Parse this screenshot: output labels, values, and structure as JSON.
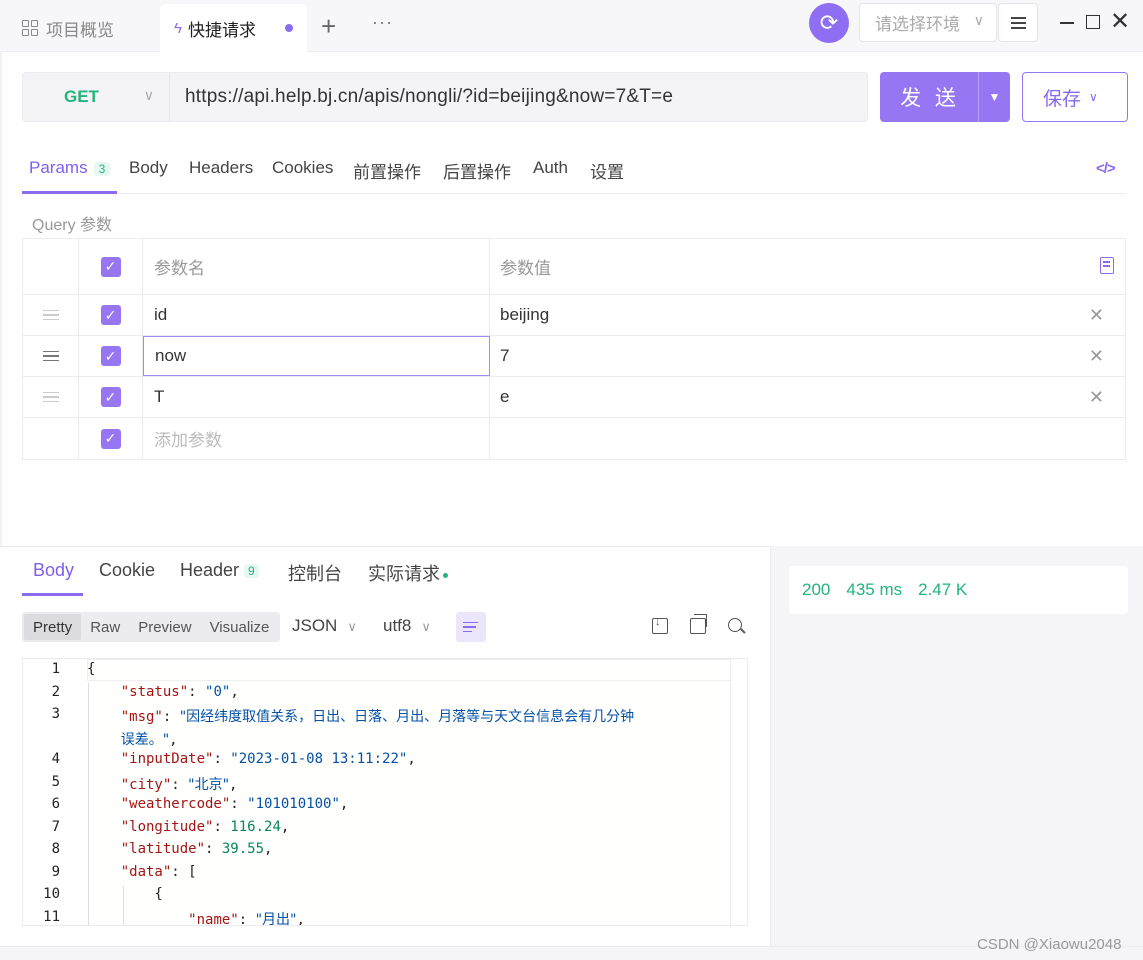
{
  "titlebar": {
    "tabs": [
      {
        "label": "项目概览"
      },
      {
        "label": "快捷请求"
      }
    ],
    "env_placeholder": "请选择环境"
  },
  "request": {
    "method": "GET",
    "url": "https://api.help.bj.cn/apis/nongli/?id=beijing&now=7&T=e",
    "send_label": "发 送",
    "save_label": "保存"
  },
  "req_tabs": [
    {
      "label": "Params",
      "badge": "3"
    },
    {
      "label": "Body"
    },
    {
      "label": "Headers"
    },
    {
      "label": "Cookies"
    },
    {
      "label": "前置操作"
    },
    {
      "label": "后置操作"
    },
    {
      "label": "Auth"
    },
    {
      "label": "设置"
    }
  ],
  "query": {
    "section_label": "Query 参数",
    "name_header": "参数名",
    "value_header": "参数值",
    "rows": [
      {
        "name": "id",
        "value": "beijing",
        "enabled": true
      },
      {
        "name": "now",
        "value": "7",
        "enabled": true
      },
      {
        "name": "T",
        "value": "e",
        "enabled": true
      }
    ],
    "add_placeholder": "添加参数"
  },
  "response": {
    "tabs": [
      {
        "label": "Body"
      },
      {
        "label": "Cookie"
      },
      {
        "label": "Header",
        "badge": "9"
      },
      {
        "label": "控制台"
      },
      {
        "label": "实际请求"
      }
    ],
    "view_modes": [
      "Pretty",
      "Raw",
      "Preview",
      "Visualize"
    ],
    "format": "JSON",
    "encoding": "utf8",
    "status": "200",
    "time": "435 ms",
    "size": "2.47 K",
    "line_numbers": [
      "1",
      "2",
      "3",
      "",
      "4",
      "5",
      "6",
      "7",
      "8",
      "9",
      "10",
      "11"
    ]
  },
  "code": {
    "l2_key": "\"status\"",
    "l2_val": "\"0\"",
    "l3_key": "\"msg\"",
    "l3_val": "\"因经纬度取值关系，日出、日落、月出、月落等与天文台信息会有几分钟",
    "l3b_val": "误差。\"",
    "l4_key": "\"inputDate\"",
    "l4_val": "\"2023-01-08 13:11:22\"",
    "l5_key": "\"city\"",
    "l5_val": "\"北京\"",
    "l6_key": "\"weathercode\"",
    "l6_val": "\"101010100\"",
    "l7_key": "\"longitude\"",
    "l7_val": "116.24",
    "l8_key": "\"latitude\"",
    "l8_val": "39.55",
    "l9_key": "\"data\"",
    "l11_key": "\"name\"",
    "l11_val": "\"月出\""
  },
  "watermark": "CSDN @Xiaowu2048"
}
